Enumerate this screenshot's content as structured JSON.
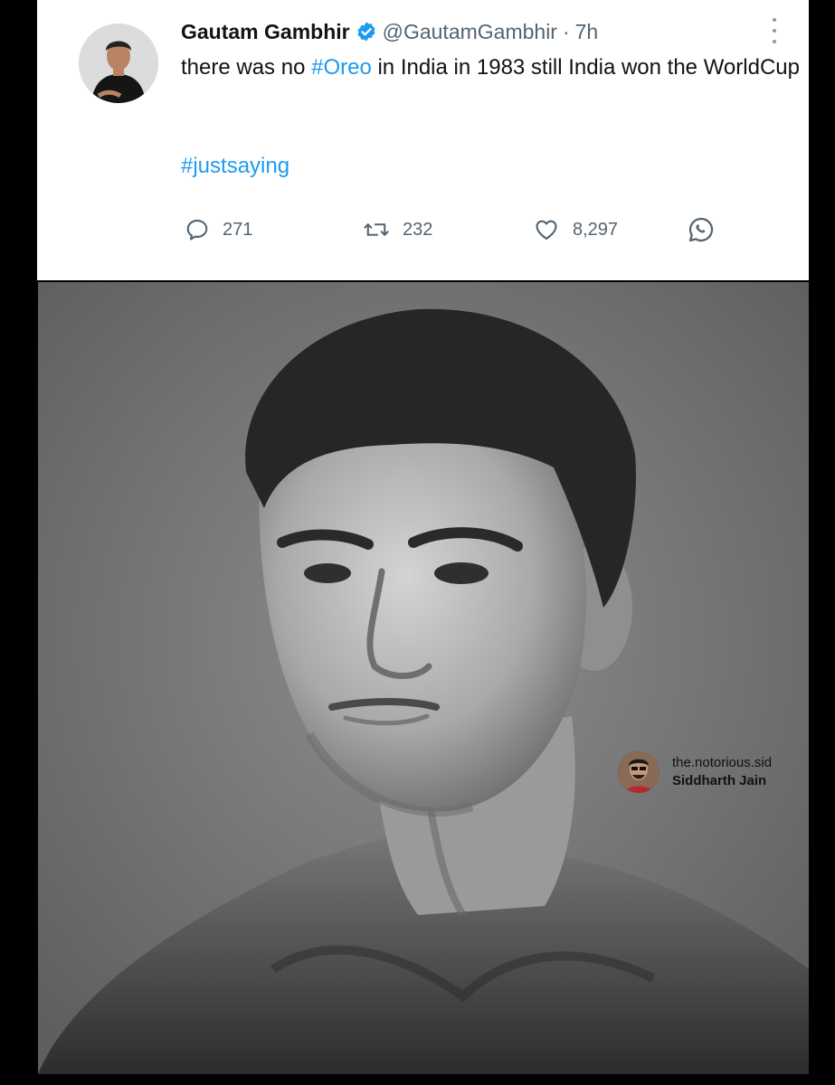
{
  "tweet": {
    "display_name": "Gautam Gambhir",
    "handle": "@GautamGambhir",
    "separator": "·",
    "time": "7h",
    "text_before": "there was no ",
    "hashtag_inline": "#Oreo",
    "text_after": " in India in 1983 still India won the WorldCup",
    "hashtag_footer": "#justsaying",
    "verified_icon": "verified-badge-icon",
    "accent_color": "#1d9bf0"
  },
  "actions": {
    "replies": "271",
    "retweets": "232",
    "likes": "8,297",
    "icons": [
      "reply-icon",
      "retweet-icon",
      "like-icon",
      "whatsapp-share-icon"
    ]
  },
  "watermark": {
    "handle": "the.notorious.sid",
    "name": "Siddharth Jain"
  }
}
